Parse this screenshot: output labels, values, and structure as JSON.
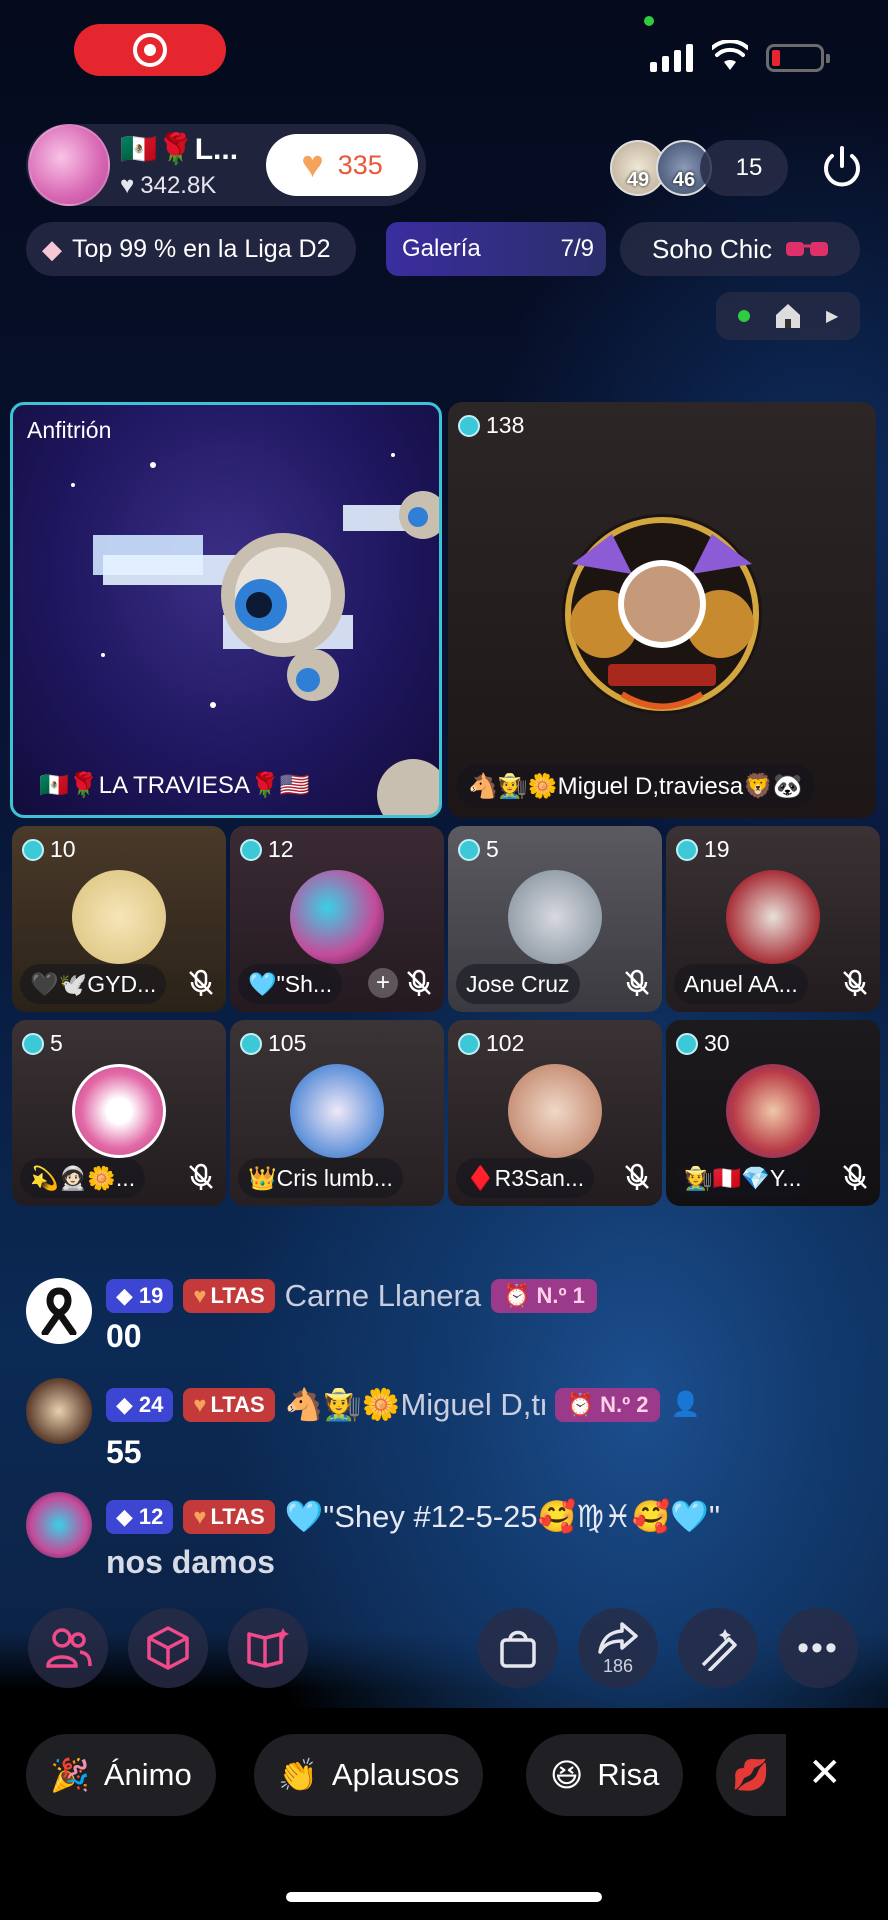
{
  "status": {
    "recording": true
  },
  "host": {
    "flags": "🇲🇽🌹L...",
    "likes": "342.8K",
    "hearts": "335"
  },
  "viewers": {
    "avatar1_level": "49",
    "avatar2_level": "46",
    "count": "15"
  },
  "pills": {
    "league": "Top 99 % en la Liga D2",
    "gallery_label": "Galería",
    "gallery_count": "7/9",
    "soho": "Soho Chic"
  },
  "seats": {
    "host": {
      "label": "Anfitrión",
      "name": "🇲🇽🌹LA TRAVIESA🌹🇺🇸"
    },
    "big2": {
      "count": "138",
      "name": "🐴🧑‍🌾🌼Miguel D,traviesa🦁🐼"
    },
    "row1": [
      {
        "count": "10",
        "name": "🖤🕊️GYD...",
        "avatar_color": "#d9c07a"
      },
      {
        "count": "12",
        "name": "🩵\"Sh...",
        "avatar_color": "#c54b9a"
      },
      {
        "count": "5",
        "name": "Jose Cruz",
        "avatar_color": "#7a8a96"
      },
      {
        "count": "19",
        "name": "Anuel AA...",
        "avatar_color": "#a82f38"
      }
    ],
    "row2": [
      {
        "count": "5",
        "name": "💫🧑🏻‍🚀🌼...",
        "avatar_color": "#e26aa8"
      },
      {
        "count": "105",
        "name": "👑Cris lumb...",
        "avatar_color": "#5b8fd8"
      },
      {
        "count": "102",
        "name": "♦️R3San...",
        "avatar_color": "#c9937a"
      },
      {
        "count": "30",
        "name": "🧑‍🌾🇵🇪💎Y...",
        "avatar_color": "#b83a46"
      }
    ]
  },
  "chat": [
    {
      "level": "19",
      "team": "LTAS",
      "name": "Carne Llanera",
      "rank": "N.º 1",
      "message": "00"
    },
    {
      "level": "24",
      "team": "LTAS",
      "name": "🐴🧑‍🌾🌼Miguel D,travi...",
      "rank": "N.º 2",
      "message": "55"
    },
    {
      "level": "12",
      "team": "LTAS",
      "name": "🩵\"Shey #12-5-25🥰♍♓🥰🩵\"",
      "message": "nos damos"
    }
  ],
  "toolbar": {
    "share_count": "186"
  },
  "reactions": [
    "Ánimo",
    "Aplausos",
    "Risa"
  ],
  "colors": {
    "accent_cyan": "#3ec3d6",
    "record_red": "#e5262e",
    "level_blue": "#3c46d2",
    "team_red": "#c43a3a"
  }
}
